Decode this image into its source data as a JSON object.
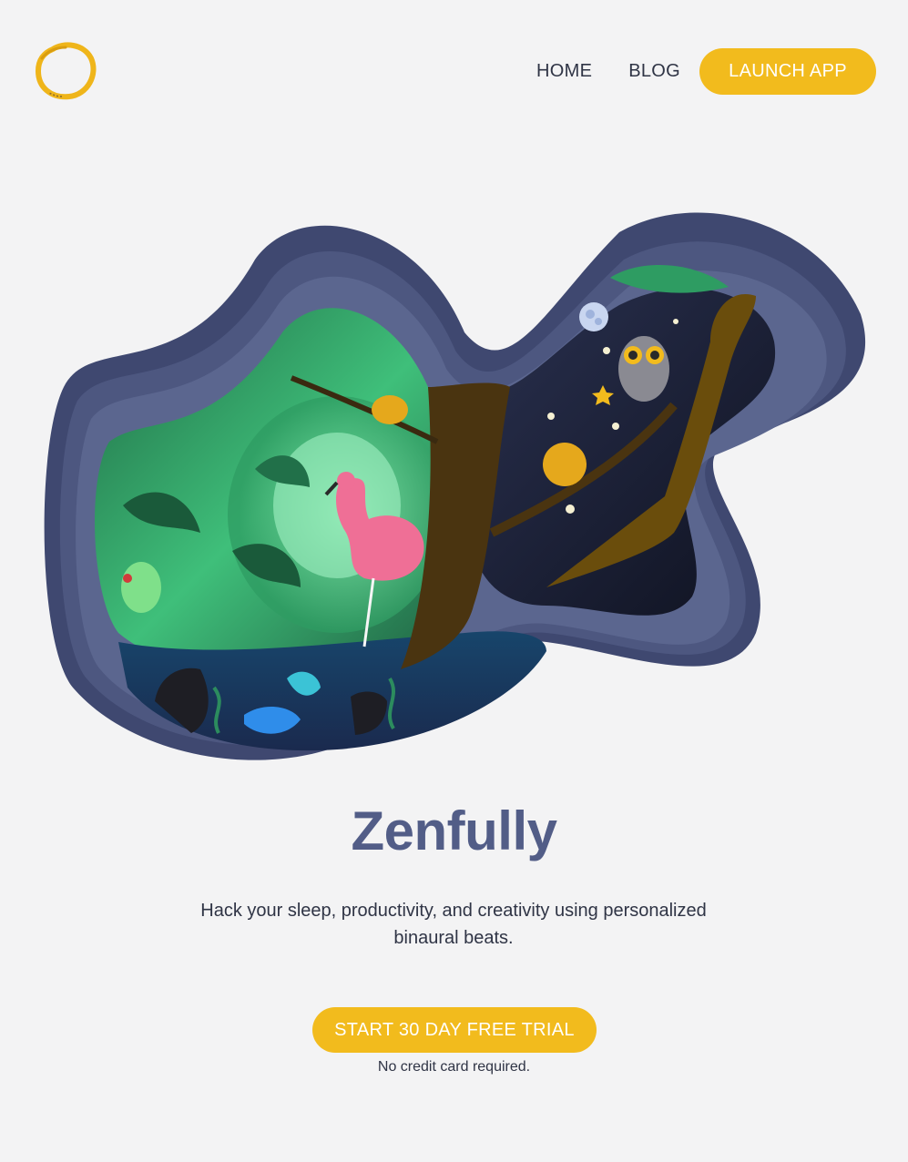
{
  "header": {
    "logo_icon": "ensō-circle-logo",
    "nav": {
      "home_label": "HOME",
      "blog_label": "BLOG",
      "launch_label": "LAUNCH APP"
    }
  },
  "hero": {
    "illustration": "papercut-night-forest-illustration",
    "title": "Zenfully",
    "subtitle": "Hack your sleep, productivity, and creativity using personalized binaural beats.",
    "cta_label": "START 30 DAY FREE TRIAL",
    "cta_note": "No credit card required."
  },
  "colors": {
    "background": "#f3f3f4",
    "accent": "#f2bb1d",
    "title": "#525d87",
    "text": "#2f3445",
    "frame": "#4d5780"
  }
}
